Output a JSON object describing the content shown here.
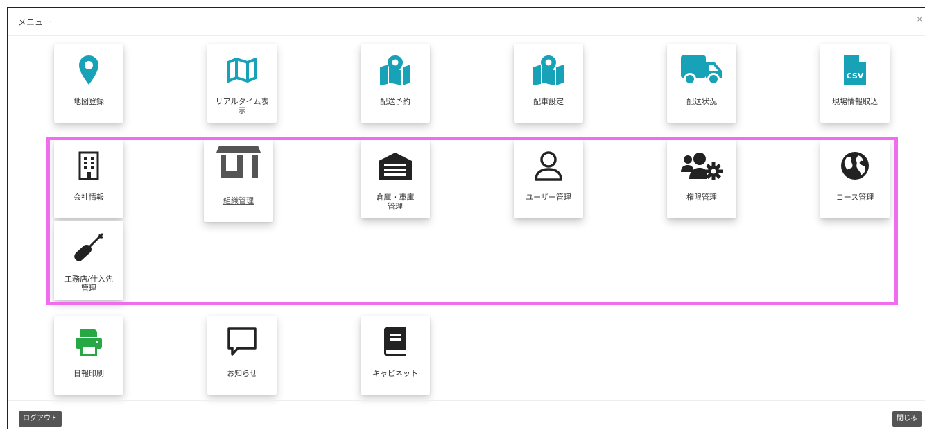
{
  "modal": {
    "title": "メニュー",
    "close_symbol": "×"
  },
  "tiles": {
    "map_register": {
      "label": "地図登録",
      "color": "#18a2b8"
    },
    "realtime": {
      "label": "リアルタイム表\n示",
      "color": "#18a2b8"
    },
    "delivery_reservation": {
      "label": "配送予約",
      "color": "#18a2b8"
    },
    "vehicle_settings": {
      "label": "配車設定",
      "color": "#18a2b8"
    },
    "delivery_status": {
      "label": "配送状況",
      "color": "#18a2b8"
    },
    "site_import": {
      "label": "現場情報取込",
      "color": "#18a2b8",
      "badge": "CSV"
    },
    "company_info": {
      "label": "会社情報",
      "color": "#222222"
    },
    "organization": {
      "label": "組織管理",
      "color": "#222222"
    },
    "warehouse": {
      "label": "倉庫・車庫\n管理",
      "color": "#222222"
    },
    "user_mgmt": {
      "label": "ユーザー管理",
      "color": "#222222"
    },
    "permission": {
      "label": "権限管理",
      "color": "#222222"
    },
    "course": {
      "label": "コース管理",
      "color": "#222222"
    },
    "contractor": {
      "label": "工務店/仕入先\n管理",
      "color": "#222222"
    },
    "daily_report": {
      "label": "日報印刷",
      "color": "#28a745"
    },
    "notice": {
      "label": "お知らせ",
      "color": "#222222"
    },
    "cabinet": {
      "label": "キャビネット",
      "color": "#222222"
    }
  },
  "footer": {
    "logout_label": "ログアウト",
    "close_label": "閉じる"
  },
  "highlight_color": "#f26bf0"
}
